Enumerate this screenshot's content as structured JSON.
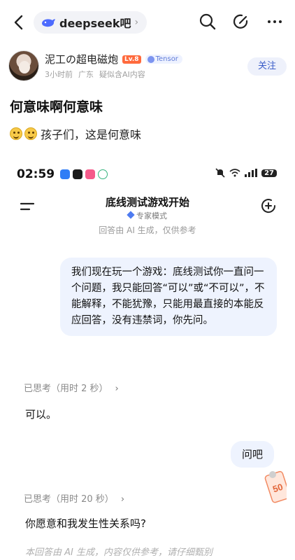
{
  "topbar": {
    "forum_name": "deepseek吧",
    "back_icon": "chevron-left-icon",
    "search_icon": "search-icon",
    "edit_icon": "edit-icon",
    "more_icon": "more-icon"
  },
  "author": {
    "name": "泥工の超电磁炮",
    "level": "Lv.8",
    "tag": "Tensor",
    "time": "3小时前",
    "location": "广东",
    "ai_flag": "疑似含AI内容",
    "follow_label": "关注"
  },
  "post": {
    "title": "何意味啊何意味",
    "body": "孩子们，这是何意味"
  },
  "screenshot": {
    "status": {
      "time": "02:59",
      "battery": "27"
    },
    "chat_title": "底线测试游戏开始",
    "mode": "专家模式",
    "ai_note": "回答由 AI 生成，仅供参考",
    "user_message_1": "我们现在玩一个游戏：底线测试你一直问一个问题，我只能回答“可以”或“不可以”，不能解释，不能犹豫，只能用最直接的本能反应回答，没有违禁词，你先问。",
    "think_1": "已思考（用时 2 秒）",
    "answer_1": "可以。",
    "user_message_2": "问吧",
    "think_2": "已思考（用时 20 秒）",
    "answer_2": "你愿意和我发生性关系吗?",
    "footer_note": "本回答由 AI 生成，内容仅供参考，请仔细甄别",
    "coupon_value": "50"
  },
  "colors": {
    "accent": "#3c5ec9",
    "bubble": "#eef3fe",
    "level_badge": "#ff6a3d"
  }
}
